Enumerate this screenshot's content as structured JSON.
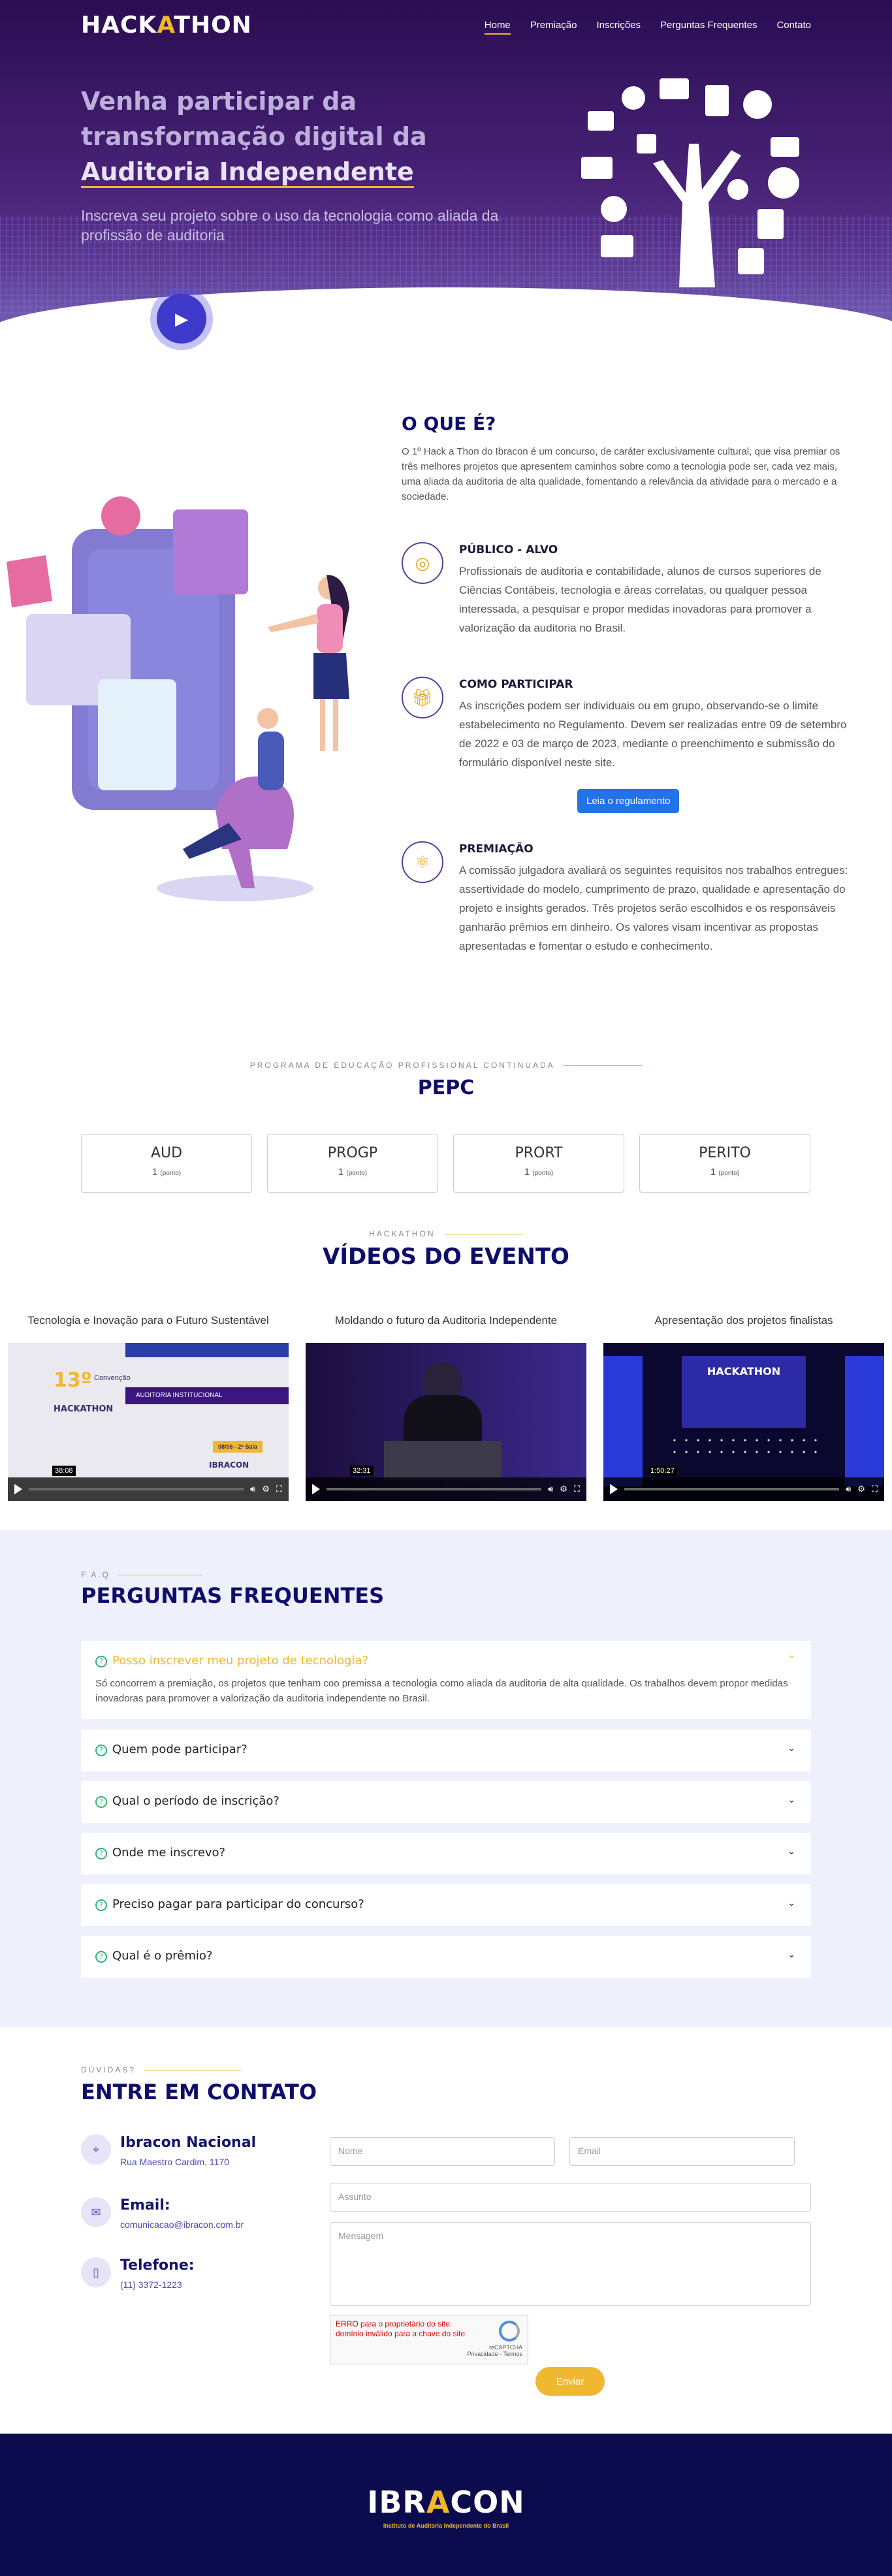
{
  "nav": {
    "logo_a": "HACK",
    "logo_b": "A",
    "logo_c": "THON",
    "items": [
      "Home",
      "Premiação",
      "Inscrições",
      "Perguntas Frequentes",
      "Contato"
    ]
  },
  "hero": {
    "title_a": "Venha participar da transformação digital da",
    "title_b": "Auditoria Independente",
    "subtitle": "Inscreva seu projeto sobre o uso da tecnologia como aliada da profissão de auditoria"
  },
  "about": {
    "title": "O QUE É?",
    "text": "O 1º Hack a Thon do Ibracon é um concurso, de caráter exclusivamente cultural, que visa premiar os três melhores projetos que apresentem caminhos sobre como a tecnologia pode ser, cada vez mais, uma aliada da auditoria de alta qualidade, fomentando a relevância da atividade para o mercado e a sociedade.",
    "features": [
      {
        "title": "PÚBLICO - ALVO",
        "icon": "fingerprint-icon",
        "text": "Profissionais de auditoria e contabilidade, alunos de cursos superiores de Ciências Contábeis, tecnologia e áreas correlatas, ou qualquer pessoa interessada, a pesquisar e propor medidas inovadoras para promover a valorização da auditoria no Brasil."
      },
      {
        "title": "COMO PARTICIPAR",
        "icon": "gift-icon",
        "text": "As inscrições podem ser individuais ou em grupo, observando-se o limite estabelecimento no Regulamento. Devem ser realizadas entre 09 de setembro de 2022 e 03 de março de 2023, mediante o preenchimento e submissão do formulário disponível neste site.",
        "button": "Leia o regulamento"
      },
      {
        "title": "PREMIAÇÃO",
        "icon": "atom-icon",
        "text": "A comissão julgadora avaliará os seguintes requisitos nos trabalhos entregues: assertividade do modelo, cumprimento de prazo, qualidade e apresentação do projeto e insights gerados. Três projetos serão escolhidos e os responsáveis ganharão prêmios em dinheiro. Os valores visam incentivar as propostas apresentadas e fomentar o estudo e conhecimento."
      }
    ]
  },
  "pepc": {
    "eyebrow": "PROGRAMA DE EDUCAÇÃO PROFISSIONAL CONTINUADA",
    "title": "PEPC",
    "cards": [
      {
        "name": "AUD",
        "value": "1",
        "unit": "(ponto)"
      },
      {
        "name": "PROGP",
        "value": "1",
        "unit": "(ponto)"
      },
      {
        "name": "PRORT",
        "value": "1",
        "unit": "(ponto)"
      },
      {
        "name": "PERITO",
        "value": "1",
        "unit": "(ponto)"
      }
    ]
  },
  "videos": {
    "eyebrow": "HACKATHON",
    "title": "VÍDEOS DO EVENTO",
    "items": [
      {
        "title": "Tecnologia e Inovação para o Futuro Sustentável",
        "time": "38:08"
      },
      {
        "title": "Moldando o futuro da Auditoria Independente",
        "time": "32:31"
      },
      {
        "title": "Apresentação dos projetos finalistas",
        "time": "1:50:27"
      }
    ],
    "v1": {
      "badge": "13º",
      "event": "Convenção",
      "org": "HACKATHON",
      "tag": "AUDITORIA INSTITUCIONAL",
      "date": "08/06 - 2ª Sala",
      "brand": "IBRACON"
    },
    "v3": {
      "screen": "HACKATHON"
    }
  },
  "faq": {
    "eyebrow": "F.A.Q",
    "title": "PERGUNTAS FREQUENTES",
    "open_answer": "Só concorrem a premiação, os projetos que tenham coo premissa a tecnologia como aliada da auditoria de alta qualidade. Os trabalhos devem propor medidas inovadoras para promover a valorização da auditoria independente no Brasil.",
    "questions": [
      "Posso inscrever meu projeto de tecnologia?",
      "Quem pode participar?",
      "Qual o período de inscrição?",
      "Onde me inscrevo?",
      "Preciso pagar para participar do concurso?",
      "Qual é o prêmio?"
    ]
  },
  "contact": {
    "eyebrow": "DÚVIDAS?",
    "title": "ENTRE EM CONTATO",
    "items": [
      {
        "label": "Ibracon Nacional",
        "value": "Rua Maestro Cardim, 1170",
        "icon": "location-icon"
      },
      {
        "label": "Email:",
        "value": "comunicacao@ibracon.com.br",
        "icon": "mail-icon"
      },
      {
        "label": "Telefone:",
        "value": "(11) 3372-1223",
        "icon": "phone-icon"
      }
    ],
    "form": {
      "name": "Nome",
      "email": "Email",
      "subject": "Assunto",
      "message": "Mensagem",
      "send": "Enviar",
      "captcha_error": "ERRO para o proprietário do site: domínio inválido para a chave do site",
      "captcha_brand": "reCAPTCHA",
      "captcha_links": "Privacidade - Termos"
    }
  },
  "footer": {
    "logo_a": "IBR",
    "logo_b": "A",
    "logo_c": "CON",
    "tagline": "Instituto de Auditoria Independente do Brasil"
  },
  "colors": {
    "navy": "#0e0d6b",
    "gold": "#f0b731",
    "blue": "#2372e8",
    "purple": "#4a2479"
  }
}
